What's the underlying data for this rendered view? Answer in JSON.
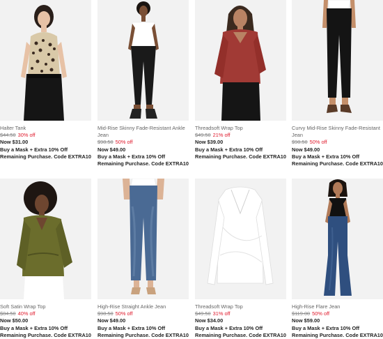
{
  "products": [
    {
      "name": "Halter Tank",
      "orig": "$44.50",
      "off": "30% off",
      "now": "Now $31.00",
      "promo": "Buy a Mask + Extra 10% Off Remaining Purchase. Code EXTRA10"
    },
    {
      "name": "Mid-Rise Skinny Fade-Resistant Ankle Jean",
      "orig": "$98.50",
      "off": "50% off",
      "now": "Now $49.00",
      "promo": "Buy a Mask + Extra 10% Off Remaining Purchase. Code EXTRA10"
    },
    {
      "name": "Threadsoft Wrap Top",
      "orig": "$49.50",
      "off": "21% off",
      "now": "Now $39.00",
      "promo": "Buy a Mask + Extra 10% Off Remaining Purchase. Code EXTRA10"
    },
    {
      "name": "Curvy Mid-Rise Skinny Fade-Resistant Jean",
      "orig": "$98.50",
      "off": "50% off",
      "now": "Now $49.00",
      "promo": "Buy a Mask + Extra 10% Off Remaining Purchase. Code EXTRA10"
    },
    {
      "name": "Soft Satin Wrap Top",
      "orig": "$84.50",
      "off": "40% off",
      "now": "Now $50.00",
      "promo": "Buy a Mask + Extra 10% Off Remaining Purchase. Code EXTRA10"
    },
    {
      "name": "High-Rise Straight Ankle Jean",
      "orig": "$98.50",
      "off": "50% off",
      "now": "Now $49.00",
      "promo": "Buy a Mask + Extra 10% Off Remaining Purchase. Code EXTRA10"
    },
    {
      "name": "Threadsoft Wrap Top",
      "orig": "$49.50",
      "off": "31% off",
      "now": "Now $34.00",
      "promo": "Buy a Mask + Extra 10% Off Remaining Purchase. Code EXTRA10"
    },
    {
      "name": "High-Rise Flare Jean",
      "orig": "$119.00",
      "off": "50% off",
      "now": "Now $59.00",
      "promo": "Buy a Mask + Extra 10% Off Remaining Purchase. Code EXTRA10"
    }
  ],
  "colors": {
    "discount": "#e0192b",
    "image_bg": "#f2f2f2",
    "text": "#222222",
    "muted": "#666666"
  }
}
